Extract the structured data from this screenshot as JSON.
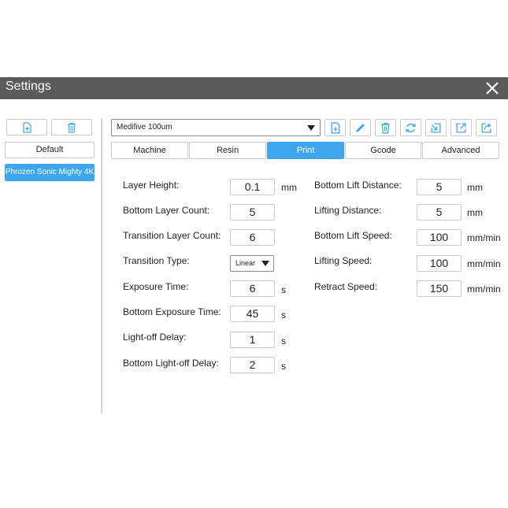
{
  "window": {
    "title": "Settings"
  },
  "sidebar": {
    "default_label": "Default",
    "profiles": [
      "Phrozen Sonic Mighty 4K"
    ]
  },
  "profile_select": {
    "value": "Medifive 100um"
  },
  "tabs": [
    {
      "label": "Machine",
      "active": false
    },
    {
      "label": "Resin",
      "active": false
    },
    {
      "label": "Print",
      "active": true
    },
    {
      "label": "Gcode",
      "active": false
    },
    {
      "label": "Advanced",
      "active": false
    }
  ],
  "left_fields": [
    {
      "label": "Layer Height:",
      "value": "0.1",
      "unit": "mm"
    },
    {
      "label": "Bottom Layer Count:",
      "value": "5",
      "unit": ""
    },
    {
      "label": "Transition Layer Count:",
      "value": "6",
      "unit": ""
    },
    {
      "label": "Transition Type:",
      "value": "Linear",
      "unit": ""
    },
    {
      "label": "Exposure Time:",
      "value": "6",
      "unit": "s"
    },
    {
      "label": "Bottom Exposure Time:",
      "value": "45",
      "unit": "s"
    },
    {
      "label": "Light-off Delay:",
      "value": "1",
      "unit": "s"
    },
    {
      "label": "Bottom Light-off Delay:",
      "value": "2",
      "unit": "s"
    }
  ],
  "right_fields": [
    {
      "label": "Bottom Lift Distance:",
      "value": "5",
      "unit": "mm"
    },
    {
      "label": "Lifting Distance:",
      "value": "5",
      "unit": "mm"
    },
    {
      "label": "Bottom Lift Speed:",
      "value": "100",
      "unit": "mm/min"
    },
    {
      "label": "Lifting Speed:",
      "value": "100",
      "unit": "mm/min"
    },
    {
      "label": "Retract Speed:",
      "value": "150",
      "unit": "mm/min"
    }
  ],
  "icons": {
    "close": "close-icon",
    "new_profile": "new-file-icon",
    "delete_profile": "trash-icon",
    "edit": "pencil-icon",
    "refresh": "refresh-icon",
    "import": "import-icon",
    "export": "export-icon",
    "share": "share-icon"
  },
  "colors": {
    "accent": "#3ea6ef",
    "titlebar": "#5b5b5b",
    "icon": "#3ea6ef"
  }
}
